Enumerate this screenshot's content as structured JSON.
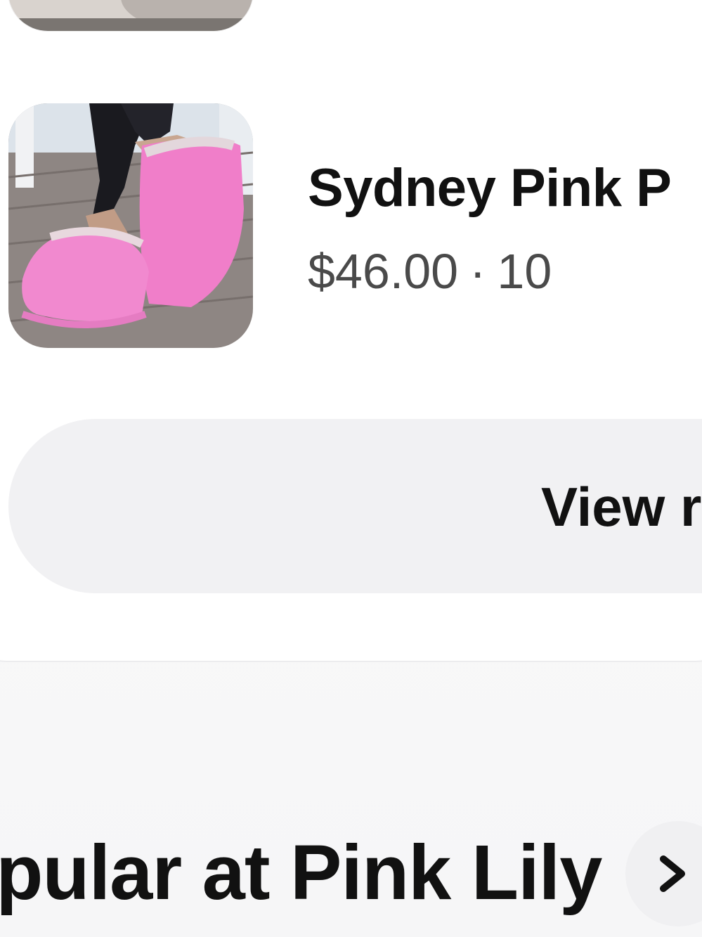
{
  "item": {
    "title": "Sydney Pink P",
    "price": "$46.00",
    "separator": "·",
    "count": "10",
    "image_icon": "pink-slipper-photo"
  },
  "view_button": {
    "label": "View r"
  },
  "section": {
    "title": "opular at Pink Lily",
    "arrow_icon": "chevron-right-icon"
  },
  "colors": {
    "card_background": "#ffffff",
    "page_background": "#f7f7f8",
    "button_background": "#f1f1f3",
    "text_primary": "#111111",
    "text_secondary": "#4a4a4a",
    "product_pink": "#ef7cc8"
  }
}
